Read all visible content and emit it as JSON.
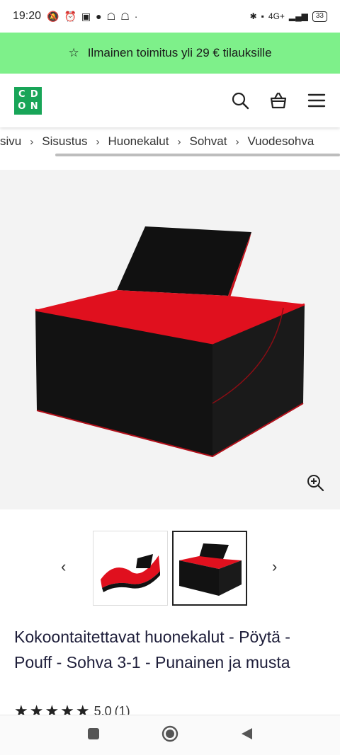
{
  "status": {
    "time": "19:20",
    "network": "4G+",
    "battery": "33"
  },
  "promo": {
    "text": "Ilmainen toimitus yli 29 € tilauksille"
  },
  "logo": {
    "letters": [
      "C",
      "D",
      "O",
      "N"
    ],
    "brand_color": "#18a558"
  },
  "breadcrumb": [
    "sivu",
    "Sisustus",
    "Huonekalut",
    "Sohvat",
    "Vuodesohva"
  ],
  "product": {
    "title": "Kokoontaitettavat huonekalut - Pöytä - Pouff - Sohva 3-1 - Punainen ja musta",
    "rating_value": "5.0",
    "rating_count": "(1)",
    "stars": "★★★★★"
  },
  "thumbnails": {
    "count": 2,
    "selected_index": 1,
    "prev_label": "‹",
    "next_label": "›"
  },
  "colors": {
    "promo_bg": "#7ef08a",
    "product_red": "#e0101e",
    "product_black": "#111111"
  }
}
